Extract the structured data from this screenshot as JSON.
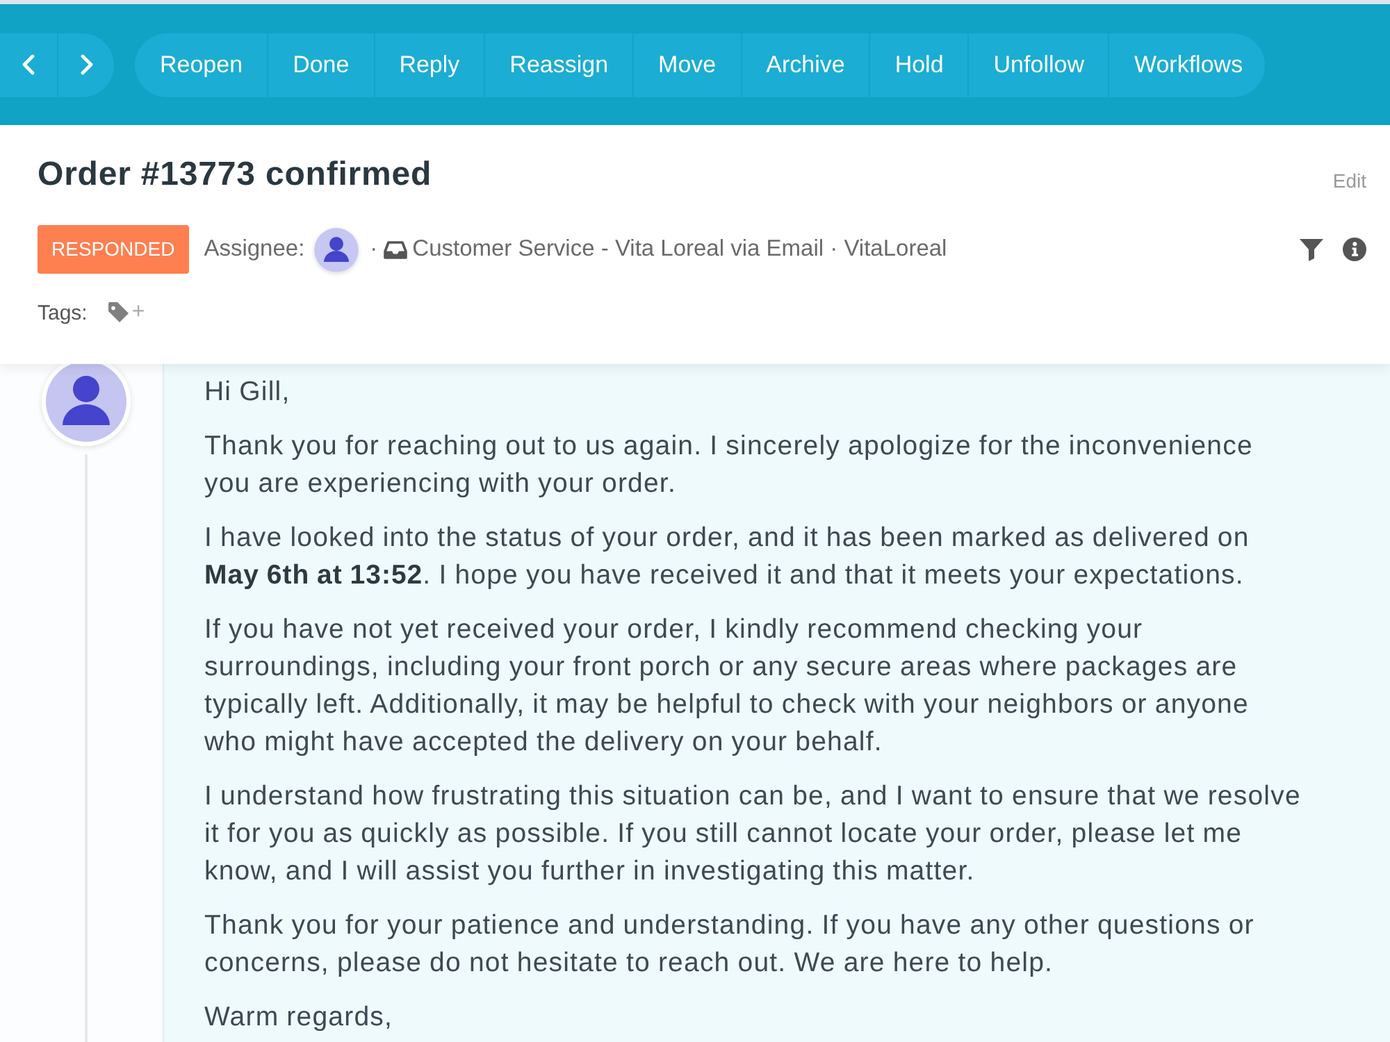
{
  "toolbar": {
    "actions": [
      "Reopen",
      "Done",
      "Reply",
      "Reassign",
      "Move",
      "Archive",
      "Hold",
      "Unfollow",
      "Workflows"
    ]
  },
  "ticket": {
    "title": "Order #13773 confirmed",
    "edit": "Edit",
    "status": "RESPONDED",
    "assignee_label": "Assignee:",
    "separator": "·",
    "channel": "Customer Service - Vita Loreal via Email · VitaLoreal",
    "tags_label": "Tags:",
    "add_tag": "+"
  },
  "message": {
    "paragraphs": [
      "Hi Gill,",
      "Thank you for reaching out to us again. I sincerely apologize for the inconvenience you are experiencing with your order.",
      "I have looked into the status of your order, and it has been marked as delivered on **May 6th at 13:52**. I hope you have received it and that it meets your expectations.",
      "If you have not yet received your order, I kindly recommend checking your surroundings, including your front porch or any secure areas where packages are typically left. Additionally, it may be helpful to check with your neighbors or anyone who might have accepted the delivery on your behalf.",
      "I understand how frustrating this situation can be, and I want to ensure that we resolve it for you as quickly as possible. If you still cannot locate your order, please let me know, and I will assist you further in investigating this matter.",
      "Thank you for your patience and understanding. If you have any other questions or concerns, please do not hesitate to reach out. We are here to help.",
      "Warm regards,"
    ]
  }
}
